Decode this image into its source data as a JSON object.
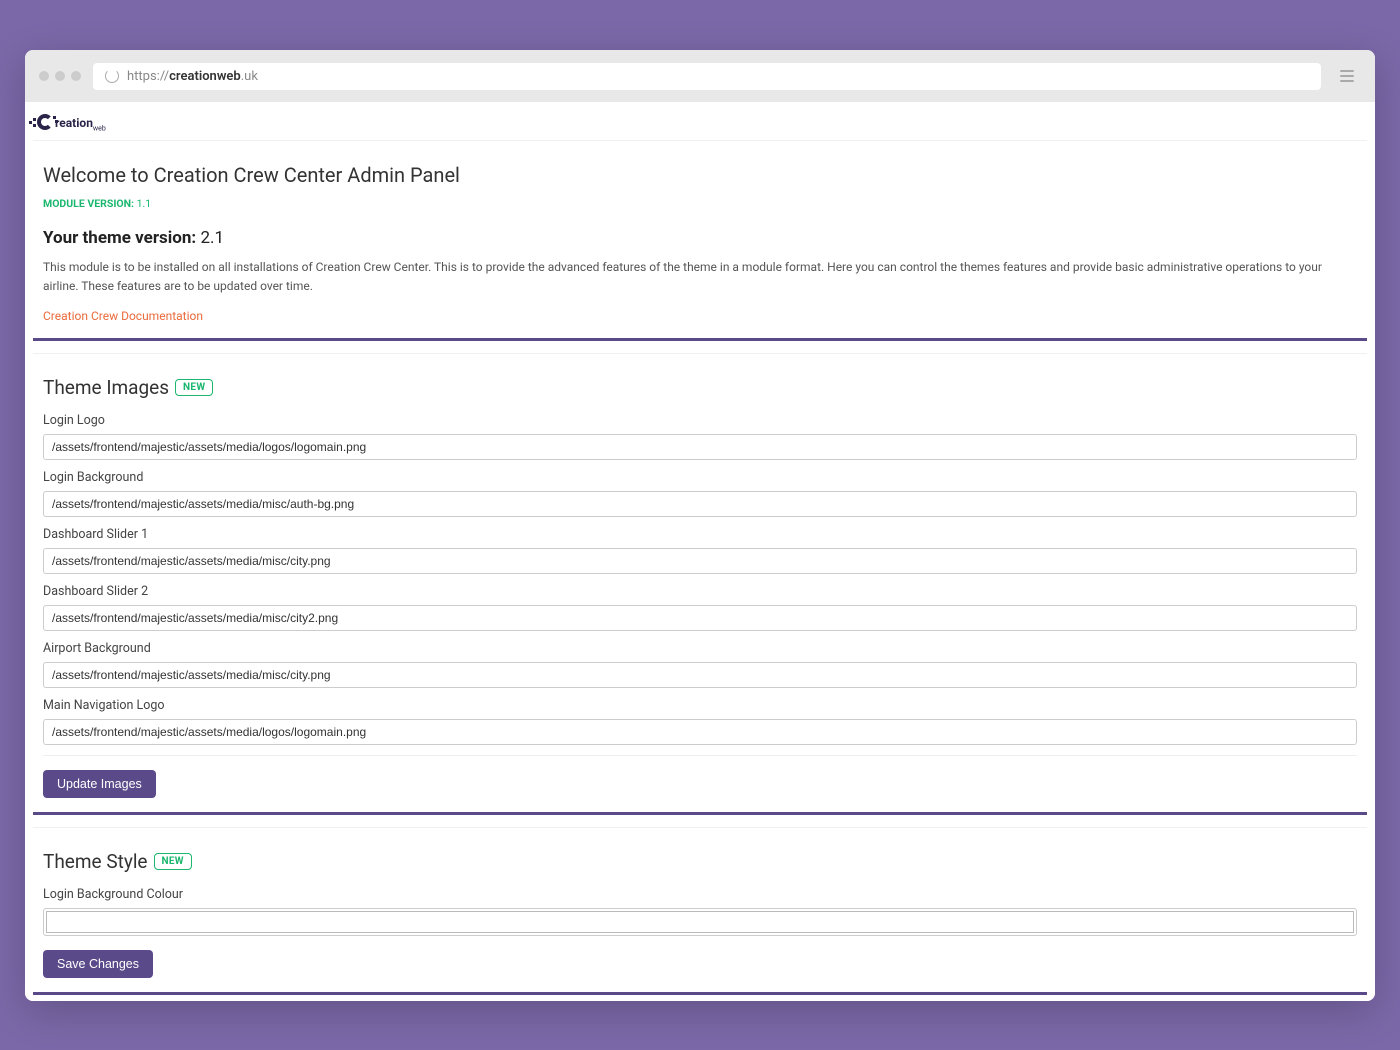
{
  "browser": {
    "url_prefix": "https://",
    "url_host": "creationweb",
    "url_tld": ".uk"
  },
  "logo": {
    "text": "reation",
    "sub": "web"
  },
  "welcome": {
    "title": "Welcome to Creation Crew Center Admin Panel",
    "module_version_label": "MODULE VERSION:",
    "module_version_value": "1.1",
    "theme_version_label": "Your theme version:",
    "theme_version_value": "2.1",
    "description": "This module is to be installed on all installations of Creation Crew Center. This is to provide the advanced features of the theme in a module format. Here you can control the themes features and provide basic administrative operations to your airline. These features are to be updated over time.",
    "doc_link_text": "Creation Crew Documentation"
  },
  "theme_images": {
    "title": "Theme Images",
    "badge": "NEW",
    "fields": [
      {
        "label": "Login Logo",
        "value": "/assets/frontend/majestic/assets/media/logos/logomain.png"
      },
      {
        "label": "Login Background",
        "value": "/assets/frontend/majestic/assets/media/misc/auth-bg.png"
      },
      {
        "label": "Dashboard Slider 1",
        "value": "/assets/frontend/majestic/assets/media/misc/city.png"
      },
      {
        "label": "Dashboard Slider 2",
        "value": "/assets/frontend/majestic/assets/media/misc/city2.png"
      },
      {
        "label": "Airport Background",
        "value": "/assets/frontend/majestic/assets/media/misc/city.png"
      },
      {
        "label": "Main Navigation Logo",
        "value": "/assets/frontend/majestic/assets/media/logos/logomain.png"
      }
    ],
    "submit": "Update Images"
  },
  "theme_style": {
    "title": "Theme Style",
    "badge": "NEW",
    "color_label": "Login Background Colour",
    "color_value": "#ffffff",
    "submit": "Save Changes"
  }
}
